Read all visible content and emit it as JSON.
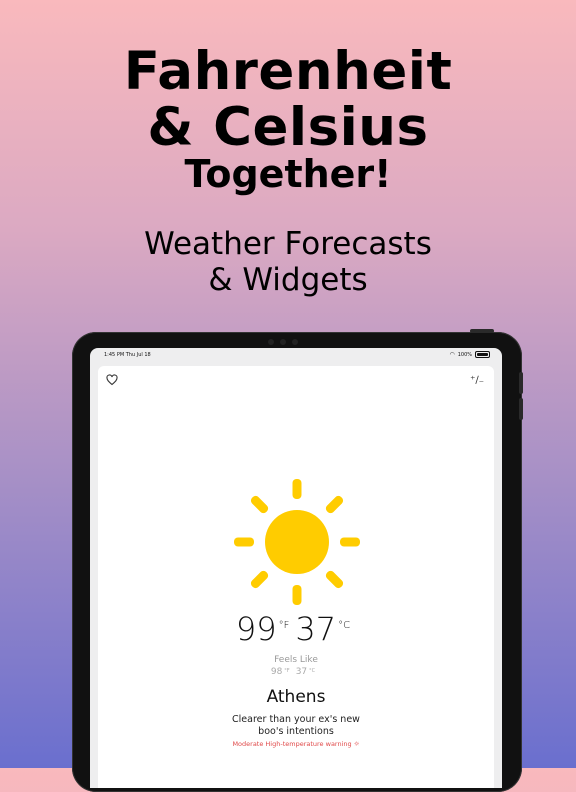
{
  "headline": {
    "line1": "Fahrenheit",
    "line2": "& Celsius",
    "line3": "Together!"
  },
  "subheadline": {
    "line1": "Weather Forecasts",
    "line2": "& Widgets"
  },
  "statusbar": {
    "time": "1:45 PM   Thu Jul 18",
    "battery": "100%"
  },
  "weather": {
    "temp_f": "99",
    "unit_f": "°F",
    "temp_c": "37",
    "unit_c": "°C",
    "feels_like_label": "Feels Like",
    "feels_f": "98",
    "feels_unit_f": "°F",
    "feels_c": "37",
    "feels_unit_c": "°C",
    "city": "Athens",
    "description_line1": "Clearer than your ex's new",
    "description_line2": "boo's intentions",
    "warning": "Moderate High-temperature warning"
  },
  "icons": {
    "favorite": "heart-icon",
    "units": "plus-minus-icon",
    "condition": "sun-icon",
    "warning": "heat-icon"
  },
  "colors": {
    "sun": "#ffcc00",
    "warning": "#e04a4a"
  }
}
